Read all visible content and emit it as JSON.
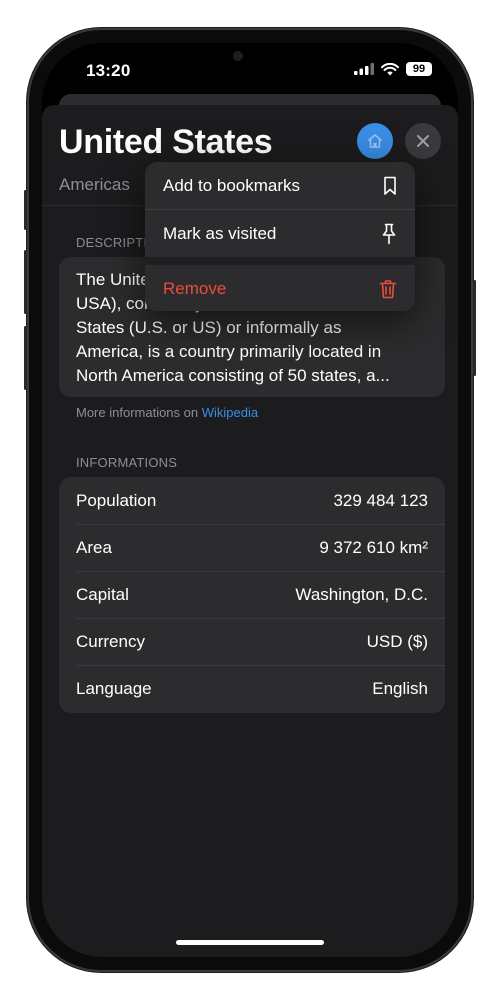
{
  "status_bar": {
    "time": "13:20",
    "battery": "99"
  },
  "header": {
    "title": "United States",
    "subtitle": "Americas"
  },
  "context_menu": {
    "items": [
      {
        "label": "Add to bookmarks",
        "icon": "bookmark-icon"
      },
      {
        "label": "Mark as visited",
        "icon": "pin-icon"
      },
      {
        "label": "Remove",
        "icon": "trash-icon",
        "destructive": true
      }
    ]
  },
  "description": {
    "header": "DESCRIPTION",
    "line1": "The United States of America (U.S.A. or",
    "line2": "USA), commonly known as the United",
    "line3": "States (U.S. or US) or informally as",
    "line4": "America, is a country primarily located in",
    "line5": "North America consisting of 50 states, a...",
    "more_prefix": "More informations on",
    "more_link": "Wikipedia"
  },
  "informations": {
    "header": "INFORMATIONS",
    "rows": [
      {
        "label": "Population",
        "value": "329 484 123"
      },
      {
        "label": "Area",
        "value": "9 372 610 km²"
      },
      {
        "label": "Capital",
        "value": "Washington, D.C."
      },
      {
        "label": "Currency",
        "value": "USD ($)"
      },
      {
        "label": "Language",
        "value": "English"
      }
    ]
  },
  "colors": {
    "accent": "#3a8ee6",
    "destructive": "#ec4b3f",
    "sheet_bg": "#1c1c1e",
    "card_bg": "#2c2c2e"
  }
}
